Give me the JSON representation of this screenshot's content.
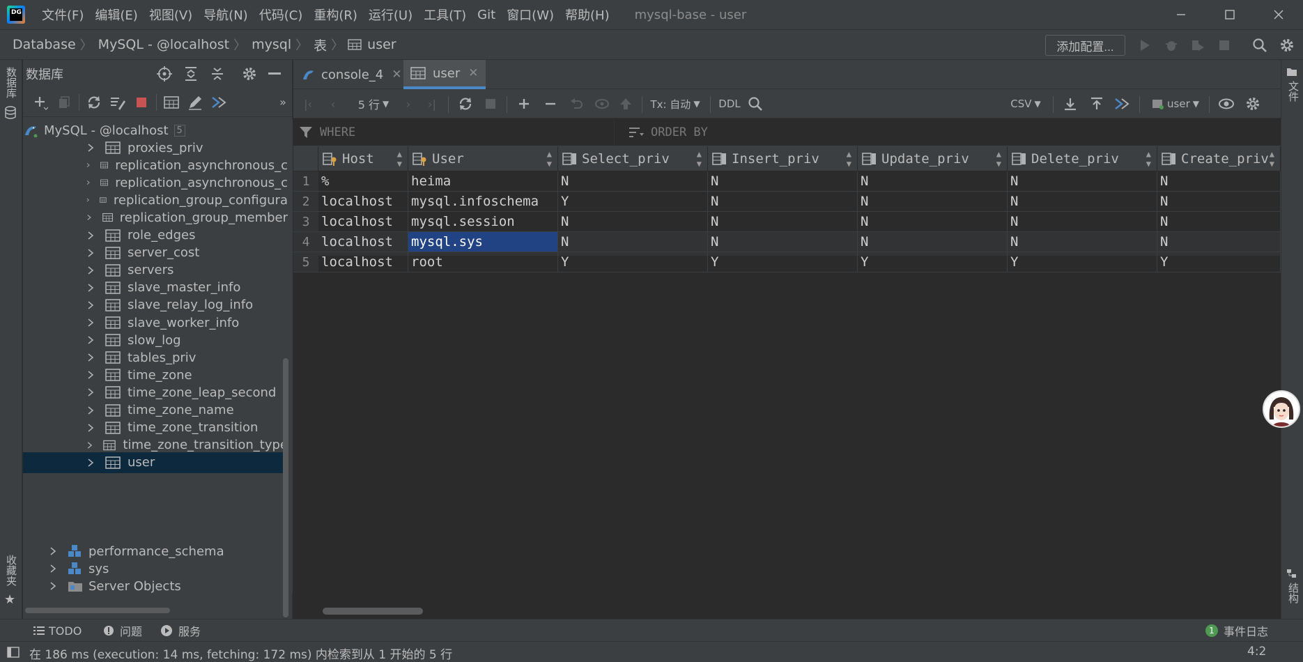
{
  "app": {
    "logo_text": "DG",
    "window_title": "mysql-base - user",
    "menu": [
      "文件(F)",
      "编辑(E)",
      "视图(V)",
      "导航(N)",
      "代码(C)",
      "重构(R)",
      "运行(U)",
      "工具(T)",
      "Git",
      "窗口(W)",
      "帮助(H)"
    ]
  },
  "breadcrumb": [
    "Database",
    "MySQL - @localhost",
    "mysql",
    "表",
    "user"
  ],
  "navbar": {
    "add_config": "添加配置..."
  },
  "stripes": {
    "left_top": "数据库",
    "left_bottom": "收藏夹",
    "right_top": "文件",
    "right_bottom": "结构"
  },
  "db_panel": {
    "title": "数据库",
    "root": {
      "label": "MySQL - @localhost",
      "count": "5"
    },
    "tables": [
      "proxies_priv",
      "replication_asynchronous_c",
      "replication_asynchronous_c",
      "replication_group_configura",
      "replication_group_member",
      "role_edges",
      "server_cost",
      "servers",
      "slave_master_info",
      "slave_relay_log_info",
      "slave_worker_info",
      "slow_log",
      "tables_priv",
      "time_zone",
      "time_zone_leap_second",
      "time_zone_name",
      "time_zone_transition",
      "time_zone_transition_type",
      "user"
    ],
    "schemas": [
      "performance_schema",
      "sys"
    ],
    "server_objects": "Server Objects"
  },
  "editor": {
    "tabs": [
      {
        "label": "console_4"
      },
      {
        "label": "user"
      }
    ],
    "toolbar": {
      "rows": "5 行",
      "tx": "Tx: 自动",
      "ddl": "DDL",
      "export_format": "CSV",
      "session": "user"
    },
    "filter": {
      "where": "WHERE",
      "order_by": "ORDER BY"
    }
  },
  "grid": {
    "columns": [
      "Host",
      "User",
      "Select_priv",
      "Insert_priv",
      "Update_priv",
      "Delete_priv",
      "Create_priv"
    ],
    "rows": [
      {
        "num": "1",
        "cells": [
          "%",
          "heima",
          "N",
          "N",
          "N",
          "N",
          "N"
        ]
      },
      {
        "num": "2",
        "cells": [
          "localhost",
          "mysql.infoschema",
          "Y",
          "N",
          "N",
          "N",
          "N"
        ]
      },
      {
        "num": "3",
        "cells": [
          "localhost",
          "mysql.session",
          "N",
          "N",
          "N",
          "N",
          "N"
        ]
      },
      {
        "num": "4",
        "cells": [
          "localhost",
          "mysql.sys",
          "N",
          "N",
          "N",
          "N",
          "N"
        ]
      },
      {
        "num": "5",
        "cells": [
          "localhost",
          "root",
          "Y",
          "Y",
          "Y",
          "Y",
          "Y"
        ]
      }
    ]
  },
  "bottom_tabs": {
    "todo": "TODO",
    "problems": "问题",
    "services": "服务",
    "event_log": "事件日志",
    "event_count": "1"
  },
  "status": {
    "text": "在 186 ms (execution: 14 ms, fetching: 172 ms) 内检索到从 1 开始的 5 行",
    "cursor": "4:2"
  },
  "colors": {
    "accent": "#4a88c7",
    "selection": "#214283",
    "tree_selection": "#0d293e",
    "stop_red": "#c75450",
    "bg": "#2b2b2b",
    "panel": "#3c3f41"
  }
}
